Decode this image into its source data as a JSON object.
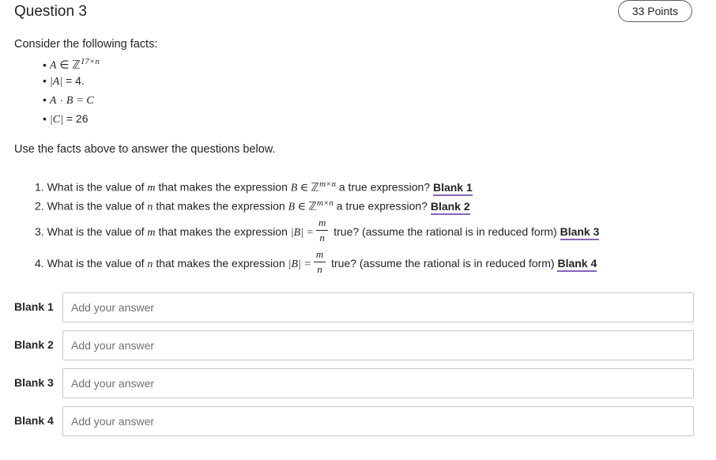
{
  "question": {
    "title": "Question 3",
    "points": "33 Points"
  },
  "intro": "Consider the following facts:",
  "facts": {
    "f1_var": "A",
    "f1_in": "∈",
    "f1_set": "ℤ",
    "f1_exp": "17×n",
    "f2_expr": "|A|",
    "f2_rest": "= 4.",
    "f3_a": "A",
    "f3_dot": "·",
    "f3_b": "B",
    "f3_eq": "= C",
    "f4_expr": "|C|",
    "f4_rest": "= 26"
  },
  "use_facts": "Use the facts above to answer the questions below.",
  "questions": {
    "q1": {
      "pre": "1. What is the value of",
      "var": "m",
      "mid": "that makes the expression",
      "expr": "B ∈ ",
      "set": "ℤ",
      "exp": "m×n",
      "post": "a true expression?",
      "blank": "Blank 1"
    },
    "q2": {
      "pre": "2. What is the value of",
      "var": "n",
      "mid": "that makes the expression",
      "expr": "B ∈ ",
      "set": "ℤ",
      "exp": "m×n",
      "post": "a true expression?",
      "blank": "Blank 2"
    },
    "q3": {
      "pre": "3. What is the value of",
      "var": "m",
      "mid": "that makes the expression",
      "expr": "|B| =",
      "num": "m",
      "den": "n",
      "post": "true? (assume the rational is in reduced form)",
      "blank": "Blank 3"
    },
    "q4": {
      "pre": "4. What is the value of",
      "var": "n",
      "mid": "that makes the expression",
      "expr": "|B| =",
      "num": "m",
      "den": "n",
      "post": "true? (assume the rational is in reduced form)",
      "blank": "Blank 4"
    }
  },
  "answers": [
    {
      "label": "Blank 1",
      "placeholder": "Add your answer"
    },
    {
      "label": "Blank 2",
      "placeholder": "Add your answer"
    },
    {
      "label": "Blank 3",
      "placeholder": "Add your answer"
    },
    {
      "label": "Blank 4",
      "placeholder": "Add your answer"
    }
  ]
}
